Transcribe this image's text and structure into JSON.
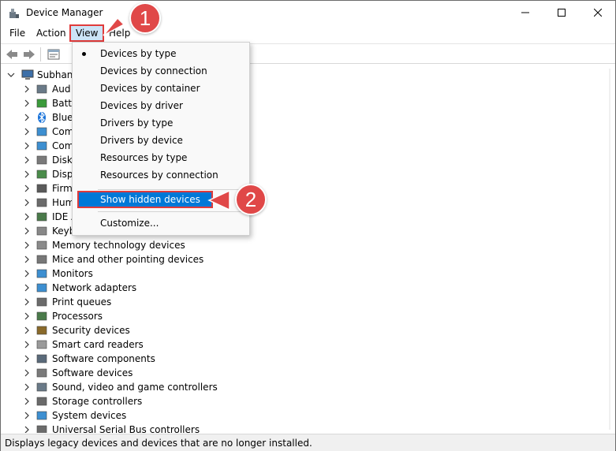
{
  "window": {
    "title": "Device Manager",
    "icon": "device-manager-icon"
  },
  "menubar": {
    "items": [
      "File",
      "Action",
      "View",
      "Help"
    ]
  },
  "view_menu": {
    "items": [
      {
        "label": "Devices by type",
        "checked": true
      },
      {
        "label": "Devices by connection",
        "checked": false
      },
      {
        "label": "Devices by container",
        "checked": false
      },
      {
        "label": "Devices by driver",
        "checked": false
      },
      {
        "label": "Drivers by type",
        "checked": false
      },
      {
        "label": "Drivers by device",
        "checked": false
      },
      {
        "label": "Resources by type",
        "checked": false
      },
      {
        "label": "Resources by connection",
        "checked": false
      }
    ],
    "show_hidden": "Show hidden devices",
    "customize": "Customize..."
  },
  "tree": {
    "root": "Subhank",
    "items": [
      {
        "label": "Aud",
        "icon": "speaker-icon"
      },
      {
        "label": "Batte",
        "icon": "battery-icon"
      },
      {
        "label": "Blue",
        "icon": "bluetooth-icon"
      },
      {
        "label": "Com",
        "icon": "computer-icon"
      },
      {
        "label": "Com",
        "icon": "monitor-icon"
      },
      {
        "label": "Disk",
        "icon": "disk-icon"
      },
      {
        "label": "Disp",
        "icon": "display-adapter-icon"
      },
      {
        "label": "Firm",
        "icon": "firmware-icon"
      },
      {
        "label": "Hum",
        "icon": "hid-icon"
      },
      {
        "label": "IDE A",
        "icon": "ide-icon"
      },
      {
        "label": "Keyb",
        "icon": "keyboard-icon"
      },
      {
        "label": "Memory technology devices",
        "icon": "memory-icon"
      },
      {
        "label": "Mice and other pointing devices",
        "icon": "mouse-icon"
      },
      {
        "label": "Monitors",
        "icon": "monitor-icon"
      },
      {
        "label": "Network adapters",
        "icon": "network-icon"
      },
      {
        "label": "Print queues",
        "icon": "printer-icon"
      },
      {
        "label": "Processors",
        "icon": "processor-icon"
      },
      {
        "label": "Security devices",
        "icon": "security-icon"
      },
      {
        "label": "Smart card readers",
        "icon": "smart-card-icon"
      },
      {
        "label": "Software components",
        "icon": "software-component-icon"
      },
      {
        "label": "Software devices",
        "icon": "software-device-icon"
      },
      {
        "label": "Sound, video and game controllers",
        "icon": "speaker-icon"
      },
      {
        "label": "Storage controllers",
        "icon": "storage-icon"
      },
      {
        "label": "System devices",
        "icon": "system-icon"
      },
      {
        "label": "Universal Serial Bus controllers",
        "icon": "usb-icon"
      }
    ]
  },
  "statusbar": {
    "text": "Displays legacy devices and devices that are no longer installed."
  },
  "callouts": [
    "1",
    "2"
  ],
  "colors": {
    "highlight": "#0078d7",
    "callout": "#e04848",
    "outline": "#e03b3b"
  }
}
